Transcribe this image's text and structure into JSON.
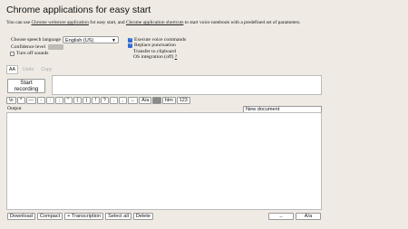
{
  "title": "Chrome applications for easy start",
  "intro": {
    "pre": "You can use ",
    "link1": "Chrome webstore application",
    "mid": " for easy start, and ",
    "link2": "Chrome application shortcuts",
    "post": " to start voice notebook with a predefined set of parameters."
  },
  "settings": {
    "language_label": "Choose speech language",
    "language_value": "English (US)",
    "confidence_label": "Confidence level",
    "turn_off_sounds": "Turn off sounds",
    "execute_voice_commands": "Execute voice commands",
    "replace_punctuation": "Replace punctuation",
    "transfer_clipboard": "Transfer to clipboard",
    "os_integration": "OS integration (off)",
    "os_integration_help": "?",
    "execute_checked": true,
    "replace_checked": true,
    "sounds_checked": false
  },
  "format": {
    "aa": "AA",
    "undo": "Undo",
    "copy": "Copy"
  },
  "start_recording": "Start recording",
  "toolbar": [
    "\\n",
    "*",
    "—",
    "-",
    ":",
    ";",
    "\"",
    "(",
    ")",
    "!",
    "?",
    ".",
    ",",
    "←",
    "A/a",
    "␣",
    "htm",
    "123"
  ],
  "output_label": "Output",
  "document_name": "New document",
  "bottom_buttons": [
    "Download",
    "Compact",
    "+ Transcription",
    "Select all",
    "Delete"
  ],
  "bottom_right": [
    "←",
    "A/a"
  ],
  "colors": {
    "background": "#efebe4",
    "checkbox": "#2e6ad3"
  }
}
